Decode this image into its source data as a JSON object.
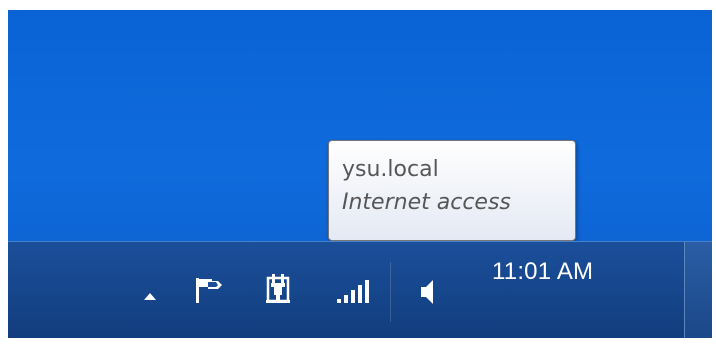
{
  "tooltip": {
    "network_name": "ysu.local",
    "connection_status": "Internet access"
  },
  "tray": {
    "icons": [
      {
        "name": "show-hidden-icons-chevron"
      },
      {
        "name": "action-center-flag-icon"
      },
      {
        "name": "power-plug-icon"
      },
      {
        "name": "network-signal-icon"
      },
      {
        "name": "volume-speaker-icon"
      }
    ]
  },
  "clock": {
    "time": "11:01 AM"
  },
  "colors": {
    "desktop_blue": "#0f6bdc",
    "taskbar_blue": "#1b4f9a",
    "tooltip_text": "#575757"
  }
}
